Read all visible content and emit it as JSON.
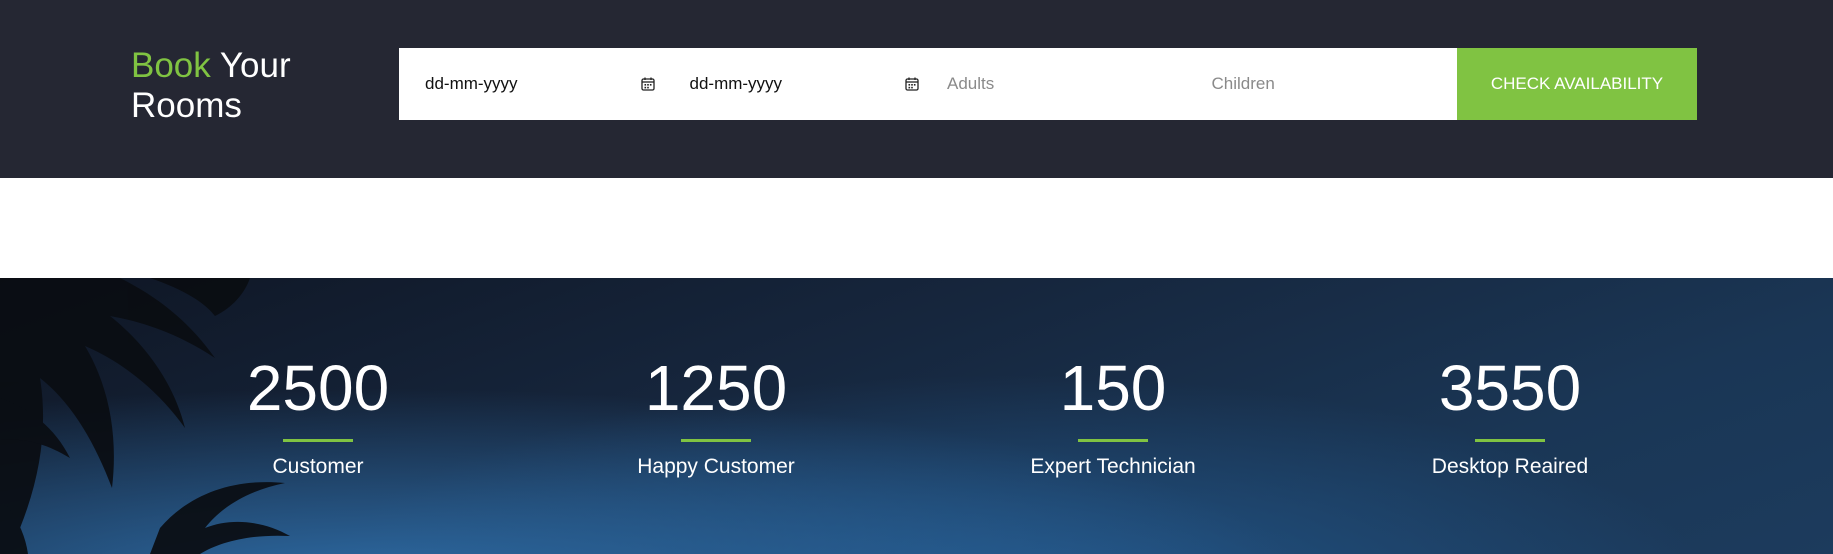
{
  "booking": {
    "title_part1": "Book",
    "title_part2": "Your",
    "title_part3": "Rooms",
    "checkin_value": "dd-mm-yyyy",
    "checkout_value": "dd-mm-yyyy",
    "adults_placeholder": "Adults",
    "children_placeholder": "Children",
    "button_label": "CHECK AVAILABILITY"
  },
  "stats": [
    {
      "number": "2500",
      "label": "Customer"
    },
    {
      "number": "1250",
      "label": "Happy Customer"
    },
    {
      "number": "150",
      "label": "Expert Technician"
    },
    {
      "number": "3550",
      "label": "Desktop Reaired"
    }
  ],
  "colors": {
    "accent": "#80c342",
    "dark_bar": "#252733",
    "stats_bg": "#1a3655"
  },
  "icons": {
    "date_picker": "calendar-icon"
  }
}
